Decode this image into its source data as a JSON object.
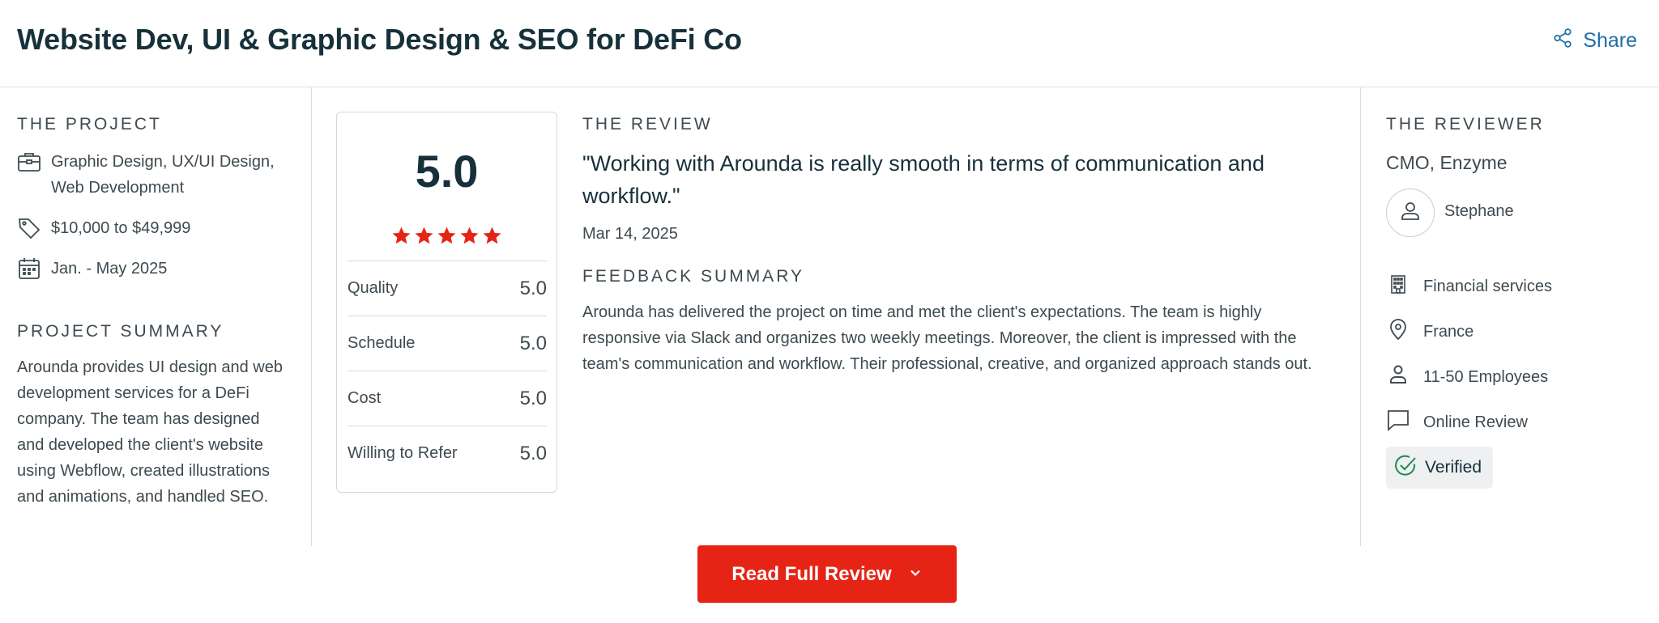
{
  "header": {
    "title": "Website Dev, UI & Graphic Design & SEO for DeFi Co",
    "share_label": "Share"
  },
  "project": {
    "section_label": "THE PROJECT",
    "services_line1": "Graphic Design, UX/UI Design,",
    "services_line2": "Web Development",
    "budget": "$10,000 to $49,999",
    "timeline": "Jan. - May 2025",
    "summary_label": "PROJECT SUMMARY",
    "summary": "Arounda provides UI design and web development services for a DeFi company. The team has designed and developed the client's website using Webflow, created illustrations and animations, and handled SEO."
  },
  "ratings": {
    "overall": "5.0",
    "stars": 5,
    "star_color": "#e62415",
    "rows": [
      {
        "label": "Quality",
        "value": "5.0"
      },
      {
        "label": "Schedule",
        "value": "5.0"
      },
      {
        "label": "Cost",
        "value": "5.0"
      },
      {
        "label": "Willing to Refer",
        "value": "5.0"
      }
    ]
  },
  "review": {
    "section_label": "THE REVIEW",
    "quote": "\"Working with Arounda is really smooth in terms of communication and workflow.\"",
    "date": "Mar 14, 2025",
    "feedback_label": "FEEDBACK SUMMARY",
    "feedback": "Arounda has delivered the project on time and met the client's expectations. The team is highly responsive via Slack and organizes two weekly meetings. Moreover, the client is impressed with the team's communication and workflow. Their professional, creative, and organized approach stands out."
  },
  "reviewer": {
    "section_label": "THE REVIEWER",
    "title": "CMO, Enzyme",
    "name": "Stephane",
    "industry": "Financial services",
    "location": "France",
    "company_size": "11-50 Employees",
    "review_type": "Online Review",
    "verified_label": "Verified",
    "verified_color": "#1c8a4e"
  },
  "cta": {
    "read_full_review": "Read Full Review"
  },
  "colors": {
    "brand_red": "#e62415",
    "link_blue": "#1f6ea6",
    "heading": "#17313b"
  }
}
